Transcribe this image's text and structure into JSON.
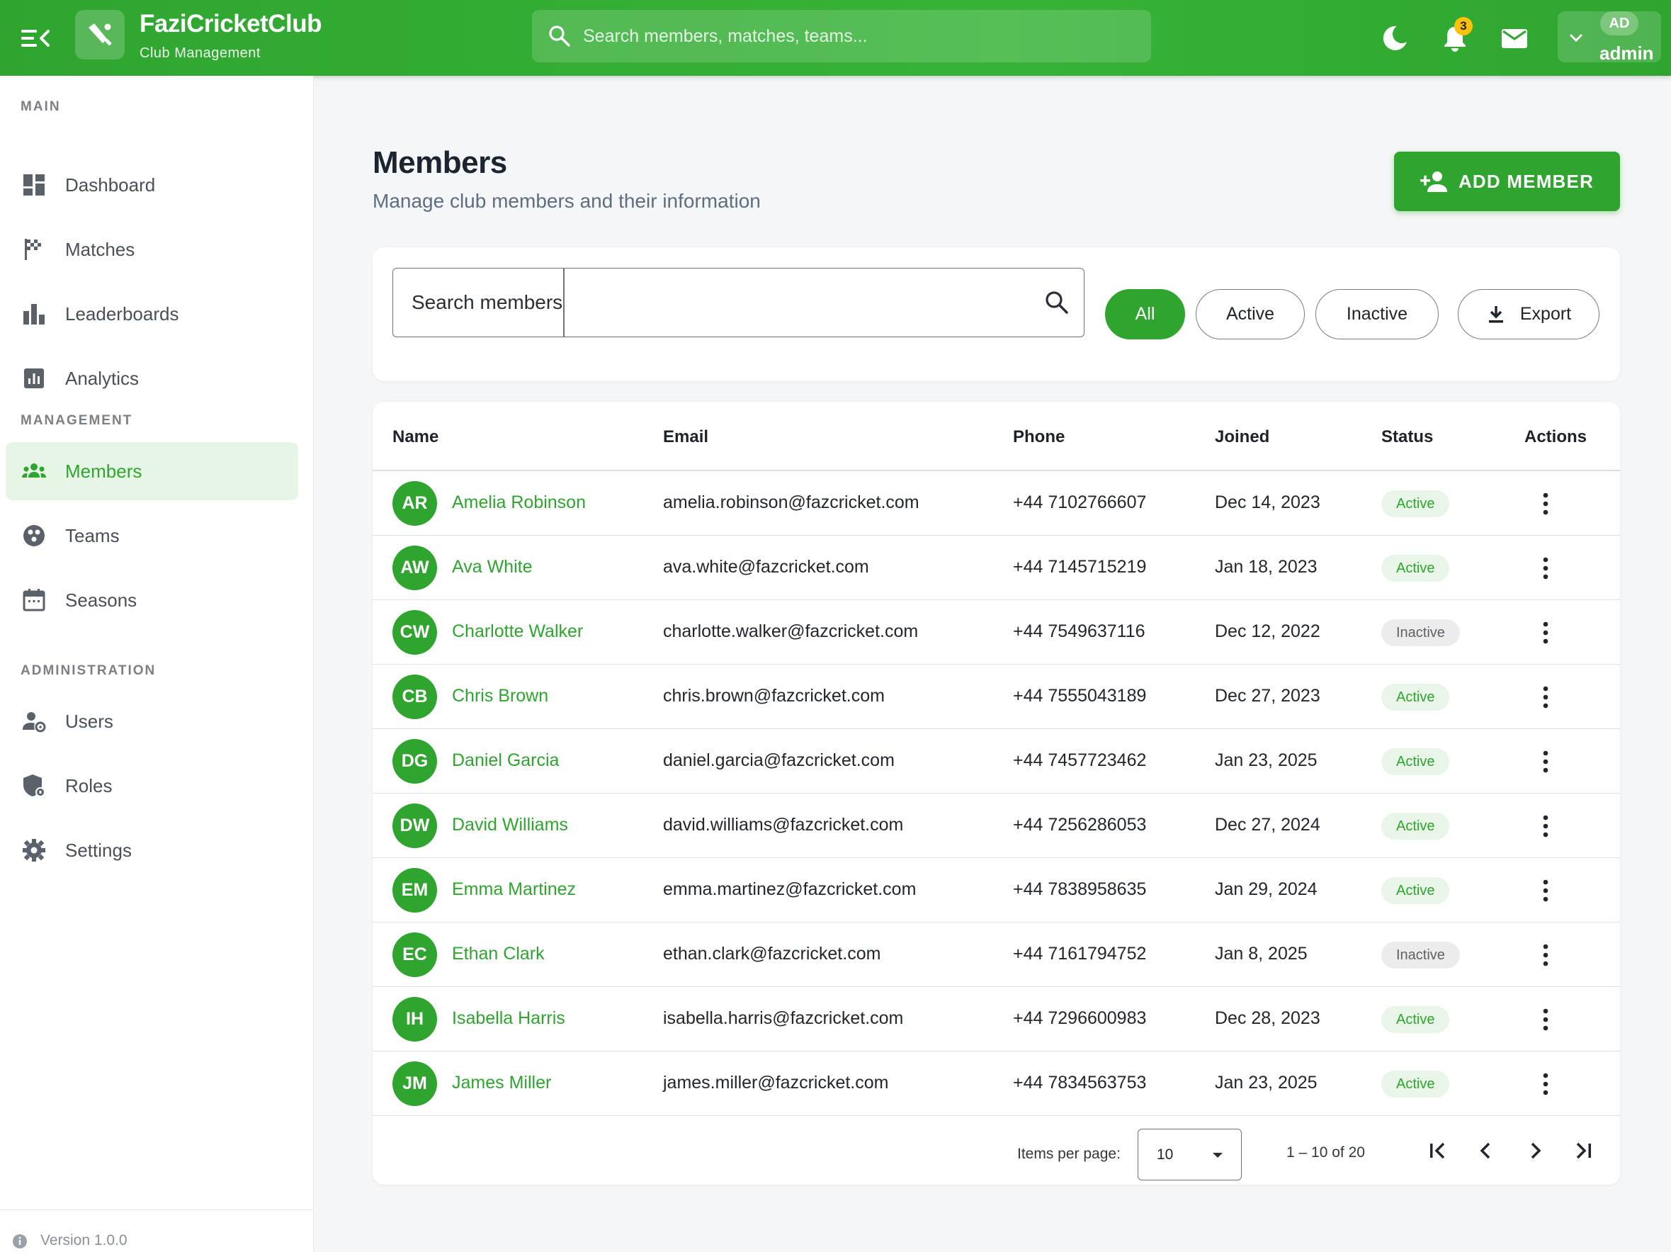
{
  "app": {
    "title": "FaziCricketClub",
    "subtitle": "Club Management",
    "search_placeholder": "Search members, matches, teams...",
    "notification_count": "3",
    "user_initials": "AD",
    "user_name": "admin"
  },
  "sidebar": {
    "sections": [
      {
        "label": "MAIN",
        "items": [
          {
            "label": "Dashboard",
            "icon": "dashboard-icon"
          },
          {
            "label": "Matches",
            "icon": "flag-icon"
          },
          {
            "label": "Leaderboards",
            "icon": "leaderboard-icon"
          },
          {
            "label": "Analytics",
            "icon": "analytics-icon"
          }
        ]
      },
      {
        "label": "MANAGEMENT",
        "items": [
          {
            "label": "Members",
            "icon": "groups-icon",
            "active": true
          },
          {
            "label": "Teams",
            "icon": "team-icon"
          },
          {
            "label": "Seasons",
            "icon": "calendar-icon"
          }
        ]
      },
      {
        "label": "ADMINISTRATION",
        "items": [
          {
            "label": "Users",
            "icon": "manage-accounts-icon"
          },
          {
            "label": "Roles",
            "icon": "shield-icon"
          },
          {
            "label": "Settings",
            "icon": "gear-icon"
          }
        ]
      }
    ],
    "version": "Version 1.0.0"
  },
  "page": {
    "title": "Members",
    "subtitle": "Manage club members and their information",
    "add_button": "ADD MEMBER"
  },
  "filters": {
    "search_placeholder": "Search members",
    "chips": [
      "All",
      "Active",
      "Inactive"
    ],
    "selected": "All",
    "export_label": "Export"
  },
  "table": {
    "columns": [
      "Name",
      "Email",
      "Phone",
      "Joined",
      "Status",
      "Actions"
    ],
    "rows": [
      {
        "initials": "AR",
        "name": "Amelia Robinson",
        "email": "amelia.robinson@fazcricket.com",
        "phone": "+44 7102766607",
        "joined": "Dec 14, 2023",
        "status": "Active"
      },
      {
        "initials": "AW",
        "name": "Ava White",
        "email": "ava.white@fazcricket.com",
        "phone": "+44 7145715219",
        "joined": "Jan 18, 2023",
        "status": "Active"
      },
      {
        "initials": "CW",
        "name": "Charlotte Walker",
        "email": "charlotte.walker@fazcricket.com",
        "phone": "+44 7549637116",
        "joined": "Dec 12, 2022",
        "status": "Inactive"
      },
      {
        "initials": "CB",
        "name": "Chris Brown",
        "email": "chris.brown@fazcricket.com",
        "phone": "+44 7555043189",
        "joined": "Dec 27, 2023",
        "status": "Active"
      },
      {
        "initials": "DG",
        "name": "Daniel Garcia",
        "email": "daniel.garcia@fazcricket.com",
        "phone": "+44 7457723462",
        "joined": "Jan 23, 2025",
        "status": "Active"
      },
      {
        "initials": "DW",
        "name": "David Williams",
        "email": "david.williams@fazcricket.com",
        "phone": "+44 7256286053",
        "joined": "Dec 27, 2024",
        "status": "Active"
      },
      {
        "initials": "EM",
        "name": "Emma Martinez",
        "email": "emma.martinez@fazcricket.com",
        "phone": "+44 7838958635",
        "joined": "Jan 29, 2024",
        "status": "Active"
      },
      {
        "initials": "EC",
        "name": "Ethan Clark",
        "email": "ethan.clark@fazcricket.com",
        "phone": "+44 7161794752",
        "joined": "Jan 8, 2025",
        "status": "Inactive"
      },
      {
        "initials": "IH",
        "name": "Isabella Harris",
        "email": "isabella.harris@fazcricket.com",
        "phone": "+44 7296600983",
        "joined": "Dec 28, 2023",
        "status": "Active"
      },
      {
        "initials": "JM",
        "name": "James Miller",
        "email": "james.miller@fazcricket.com",
        "phone": "+44 7834563753",
        "joined": "Jan 23, 2025",
        "status": "Active"
      }
    ]
  },
  "paginator": {
    "items_per_page_label": "Items per page:",
    "page_size": "10",
    "range": "1 – 10 of 20"
  },
  "colors": {
    "primary": "#2fa530",
    "active_bg": "#e8f5e8",
    "inactive_bg": "#ececec",
    "badge": "#ffc107"
  }
}
